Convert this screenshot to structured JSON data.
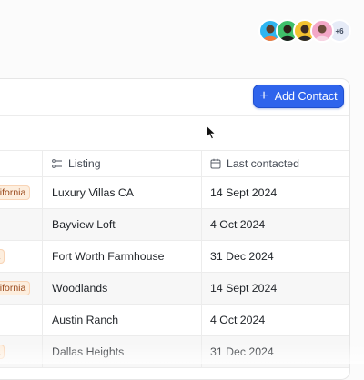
{
  "collaborators": {
    "overflow_count_label": "+6",
    "avatar_colors": [
      "#2fb5f0",
      "#3fbf6a",
      "#f2c230",
      "#f3a7c7"
    ]
  },
  "toolbar": {
    "add_contact_label": "Add Contact"
  },
  "table": {
    "columns": [
      {
        "label": "",
        "icon": null
      },
      {
        "label": "Listing",
        "icon": "list-icon"
      },
      {
        "label": "Last contacted",
        "icon": "calendar-icon"
      }
    ],
    "rows": [
      {
        "tag": "California",
        "listing": "Luxury Villas CA",
        "last_contacted": "14 Sept 2024"
      },
      {
        "tag": "",
        "listing": "Bayview Loft",
        "last_contacted": "4 Oct 2024"
      },
      {
        "tag": "ia",
        "listing": "Fort Worth Farmhouse",
        "last_contacted": "31 Dec 2024"
      },
      {
        "tag": "California",
        "listing": "Woodlands",
        "last_contacted": "14 Sept 2024"
      },
      {
        "tag": "",
        "listing": "Austin Ranch",
        "last_contacted": "4 Oct 2024"
      },
      {
        "tag": "ia",
        "listing": "Dallas Heights",
        "last_contacted": "31 Dec 2024"
      }
    ]
  },
  "colors": {
    "accent": "#2f64ec",
    "tag_bg": "#fdeede",
    "tag_text": "#9a4a1d"
  }
}
